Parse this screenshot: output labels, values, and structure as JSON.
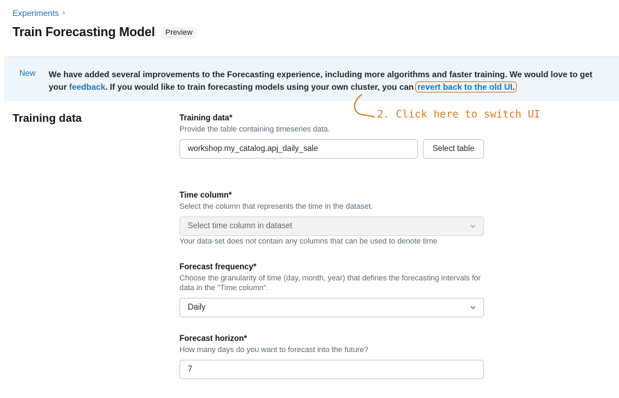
{
  "breadcrumb": {
    "link": "Experiments",
    "separator": "›"
  },
  "header": {
    "title": "Train Forecasting Model",
    "tag": "Preview"
  },
  "banner": {
    "tag": "New",
    "text_1": "We have added several improvements to the Forecasting experience, including more algorithms and faster training. We would love to get your ",
    "feedback_link": "feedback",
    "text_2": ". If you would like to train forecasting models using your own cluster, you can ",
    "revert_link": "revert back to the old UI",
    "text_3": "."
  },
  "annotation": {
    "text": "2. Click here to switch UI",
    "color": "#e07a1f"
  },
  "section": {
    "title": "Training data"
  },
  "fields": {
    "training_data": {
      "label": "Training data*",
      "help": "Provide the table containing timeseries data.",
      "value": "workshop.my_catalog.apj_daily_sale",
      "button": "Select table"
    },
    "time_column": {
      "label": "Time column*",
      "help": "Select the column that represents the time in the dataset.",
      "placeholder": "Select time column in dataset",
      "note": "Your data-set does not contain any columns that can be used to denote time"
    },
    "forecast_frequency": {
      "label": "Forecast frequency*",
      "help": "Choose the granularity of time (day, month, year) that defines the forecasting intervals for data in the \"Time column\".",
      "value": "Daily"
    },
    "forecast_horizon": {
      "label": "Forecast horizon*",
      "help": "How many days do you want to forecast into the future?",
      "value": "7"
    }
  },
  "colors": {
    "link": "#2272b4",
    "banner_bg": "#eef5fb",
    "accent_annotation": "#e07a1f"
  }
}
